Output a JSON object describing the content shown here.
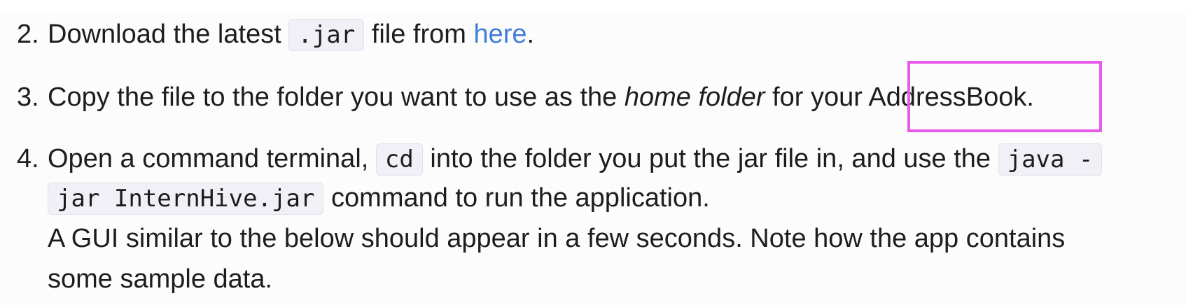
{
  "steps": [
    {
      "number": "2.",
      "pre": "Download the latest",
      "code": ".jar",
      "mid": "file from",
      "link": "here",
      "post": "."
    },
    {
      "number": "3.",
      "pre": "Copy the file to the folder you want to use as the",
      "em": "home folder",
      "mid": "for your",
      "app": "AddressBook",
      "post": "."
    },
    {
      "number": "4.",
      "pre": "Open a command terminal,",
      "code1": "cd",
      "mid": "into the folder you put the jar file in, and use the",
      "code2a": "java -",
      "code2b": "jar InternHive.jar",
      "post": "command to run the application.",
      "note_line1": "A GUI similar to the below should appear in a few seconds. Note how the app contains",
      "note_line2": "some sample data."
    }
  ],
  "highlight": {
    "color": "#e85ae8"
  }
}
